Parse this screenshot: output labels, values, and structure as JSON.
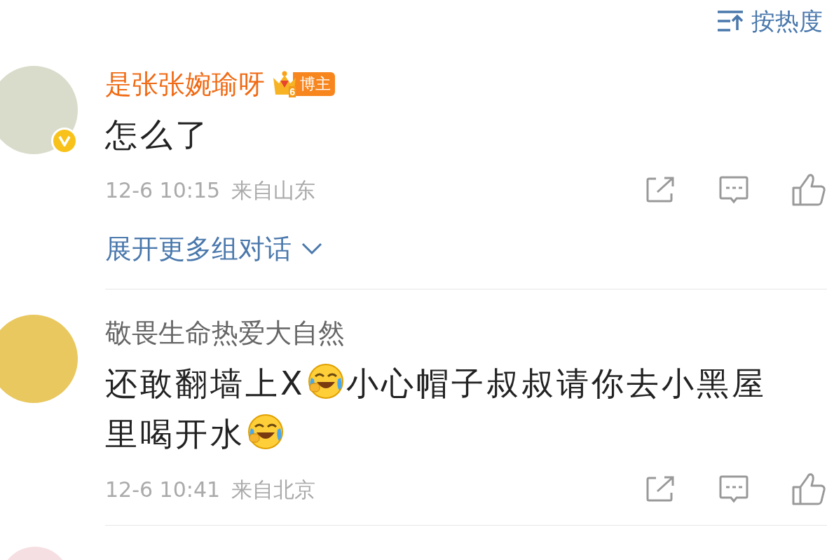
{
  "sort": {
    "label": "按热度"
  },
  "comments": [
    {
      "user": {
        "name": "是张张婉瑜呀",
        "verified": true,
        "is_author": true,
        "badge": {
          "level": "6",
          "label": "博主"
        }
      },
      "content": [
        {
          "kind": "text",
          "text": "怎么了"
        }
      ],
      "time": "12-6 10:15",
      "location": "来自山东",
      "more_link": "展开更多组对话"
    },
    {
      "user": {
        "name": "敬畏生命热爱大自然",
        "verified": false,
        "is_author": false
      },
      "content": [
        {
          "kind": "text",
          "text": "还敢翻墙上X"
        },
        {
          "kind": "emoji"
        },
        {
          "kind": "text",
          "text": "小心帽子叔叔请你去小黑屋里喝开水"
        },
        {
          "kind": "emoji"
        }
      ],
      "time": "12-6 10:41",
      "location": "来自北京"
    }
  ]
}
